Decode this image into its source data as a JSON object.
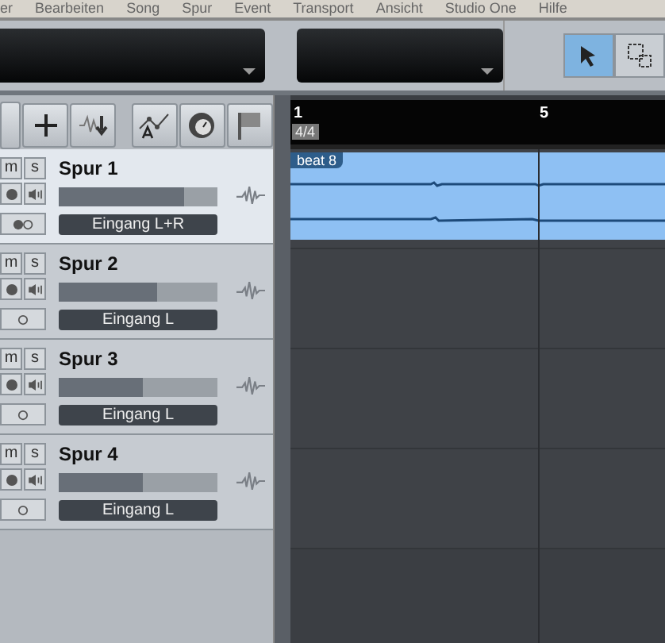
{
  "menu": [
    "er",
    "Bearbeiten",
    "Song",
    "Spur",
    "Event",
    "Transport",
    "Ansicht",
    "Studio One",
    "Hilfe"
  ],
  "tools": [
    {
      "kind": "arrow",
      "selected": true
    },
    {
      "kind": "range",
      "selected": false
    }
  ],
  "ruler": {
    "markers": [
      "1",
      "5"
    ],
    "signature": "4/4"
  },
  "tracks": [
    {
      "name": "Spur 1",
      "mute": "m",
      "solo": "s",
      "level": 0.79,
      "input": "Eingang L+R",
      "kind": "stereo",
      "selected": true,
      "clip": "beat 8"
    },
    {
      "name": "Spur 2",
      "mute": "m",
      "solo": "s",
      "level": 0.62,
      "input": "Eingang L",
      "kind": "mono",
      "selected": false
    },
    {
      "name": "Spur 3",
      "mute": "m",
      "solo": "s",
      "level": 0.53,
      "input": "Eingang L",
      "kind": "mono",
      "selected": false
    },
    {
      "name": "Spur 4",
      "mute": "m",
      "solo": "s",
      "level": 0.53,
      "input": "Eingang L",
      "kind": "mono",
      "selected": false
    }
  ]
}
